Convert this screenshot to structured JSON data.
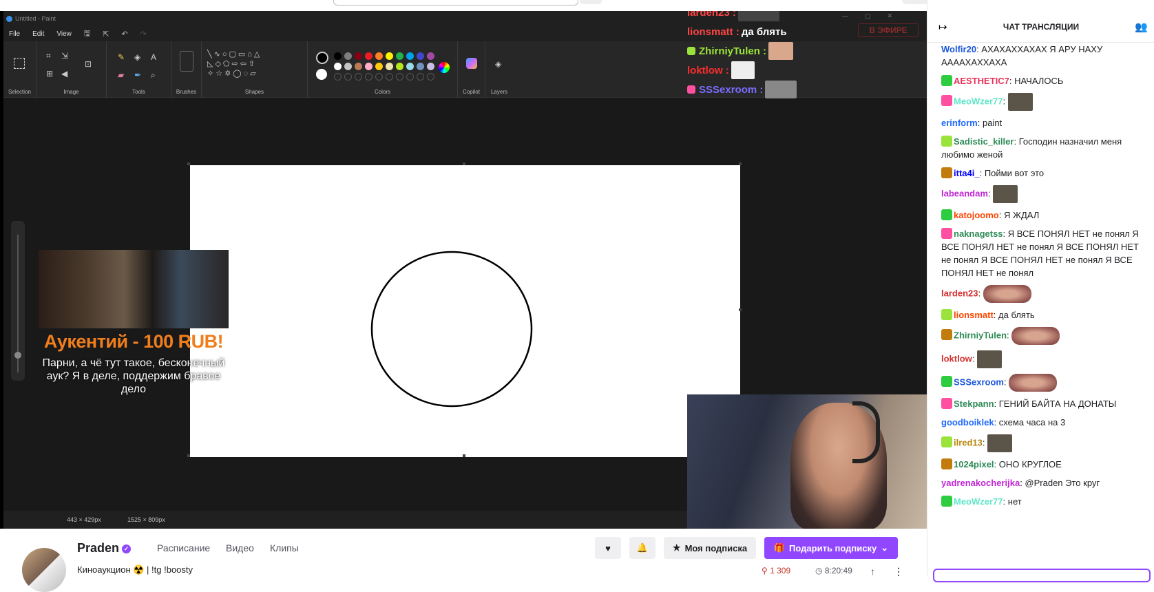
{
  "paint": {
    "title": "Untitled - Paint",
    "menu": [
      "File",
      "Edit",
      "View"
    ],
    "groups": [
      "Selection",
      "Image",
      "Tools",
      "Brushes",
      "Shapes",
      "Colors",
      "Copilot",
      "Layers"
    ],
    "status_selection": "443 × 429px",
    "status_canvas": "1525 × 809px",
    "palette_colors": [
      "#000000",
      "#7f7f7f",
      "#880015",
      "#ed1c24",
      "#ff7f27",
      "#fff200",
      "#22b14c",
      "#00a2e8",
      "#3f48cc",
      "#a349a4",
      "#ffffff",
      "#c3c3c3",
      "#b97a57",
      "#ffaec9",
      "#ffc90e",
      "#efe4b0",
      "#b5e61d",
      "#99d9ea",
      "#7092be",
      "#c8bfe7"
    ]
  },
  "overlay": {
    "auction_title": "Аукентий - 100 RUB!",
    "auction_text": "Парни, а чё тут такое, бесконечный аук? Я в деле, поддержим бравое дело",
    "live_label": "В ЭФИРЕ",
    "chat": [
      {
        "user": "larden23 :",
        "color": "#ff4545",
        "text": ""
      },
      {
        "user": "lionsmatt :",
        "color": "#ff4545",
        "text": "да блять"
      },
      {
        "user": "ZhirniyTulen :",
        "color": "#9ae33a",
        "text": ""
      },
      {
        "user": "loktlow :",
        "color": "#ff2d2d",
        "text": ""
      },
      {
        "user": "SSSexroom :",
        "color": "#7a6cff",
        "text": ""
      }
    ]
  },
  "channel": {
    "name": "Praden",
    "nav": [
      "Расписание",
      "Видео",
      "Клипы"
    ],
    "stream_title": "Киноаукцион ☢️ | !tg !boosty",
    "sub_button": "Моя подписка",
    "gift_button": "Подарить подписку",
    "viewers": "1 309",
    "uptime": "8:20:49"
  },
  "chat": {
    "header": "ЧАТ ТРАНСЛЯЦИИ",
    "messages": [
      {
        "user": "Wolfir20",
        "color": "#1a56db",
        "text": "АХАХАХХАХАХ Я АРУ НАХУ ААААХАХХАХА"
      },
      {
        "user": "AESTHETIC7",
        "color": "#e8315a",
        "text": "НАЧАЛОСЬ"
      },
      {
        "user": "MeoWzer77",
        "color": "#5fe6c8",
        "text": ""
      },
      {
        "user": "erinform",
        "color": "#1f69ff",
        "text": "paint"
      },
      {
        "user": "Sadistic_killer",
        "color": "#2e8b57",
        "text": "Господин назначил меня любимо женой"
      },
      {
        "user": "itta4i_",
        "color": "#0000ff",
        "text": "Пойми вот это"
      },
      {
        "user": "labeandam",
        "color": "#c026d3",
        "text": ""
      },
      {
        "user": "katojoomo",
        "color": "#ff4500",
        "text": "Я ЖДАЛ"
      },
      {
        "user": "naknagetss",
        "color": "#2e8b57",
        "text": "Я ВСЕ ПОНЯЛ НЕТ не понял Я ВСЕ ПОНЯЛ НЕТ не понял Я ВСЕ ПОНЯЛ НЕТ не понял Я ВСЕ ПОНЯЛ НЕТ не понял Я ВСЕ ПОНЯЛ НЕТ не понял"
      },
      {
        "user": "larden23",
        "color": "#d32f2f",
        "text": ""
      },
      {
        "user": "lionsmatt",
        "color": "#ff4500",
        "text": "да блять"
      },
      {
        "user": "ZhirniyTulen",
        "color": "#2e8b57",
        "text": ""
      },
      {
        "user": "loktlow",
        "color": "#d32f2f",
        "text": ""
      },
      {
        "user": "SSSexroom",
        "color": "#1a56db",
        "text": ""
      },
      {
        "user": "Stekpann",
        "color": "#2e8b57",
        "text": "ГЕНИЙ БАЙТА НА ДОНАТЫ"
      },
      {
        "user": "goodboiklek",
        "color": "#1f69ff",
        "text": "схема часа на 3"
      },
      {
        "user": "ilred13",
        "color": "#b8860b",
        "text": ""
      },
      {
        "user": "1024pixel",
        "color": "#2e8b57",
        "text": "ОНО КРУГЛОЕ"
      },
      {
        "user": "yadrenakocherijka",
        "color": "#c026d3",
        "text": "@Praden Это круг"
      },
      {
        "user": "MeoWzer77",
        "color": "#5fe6c8",
        "text": "нет"
      }
    ]
  }
}
